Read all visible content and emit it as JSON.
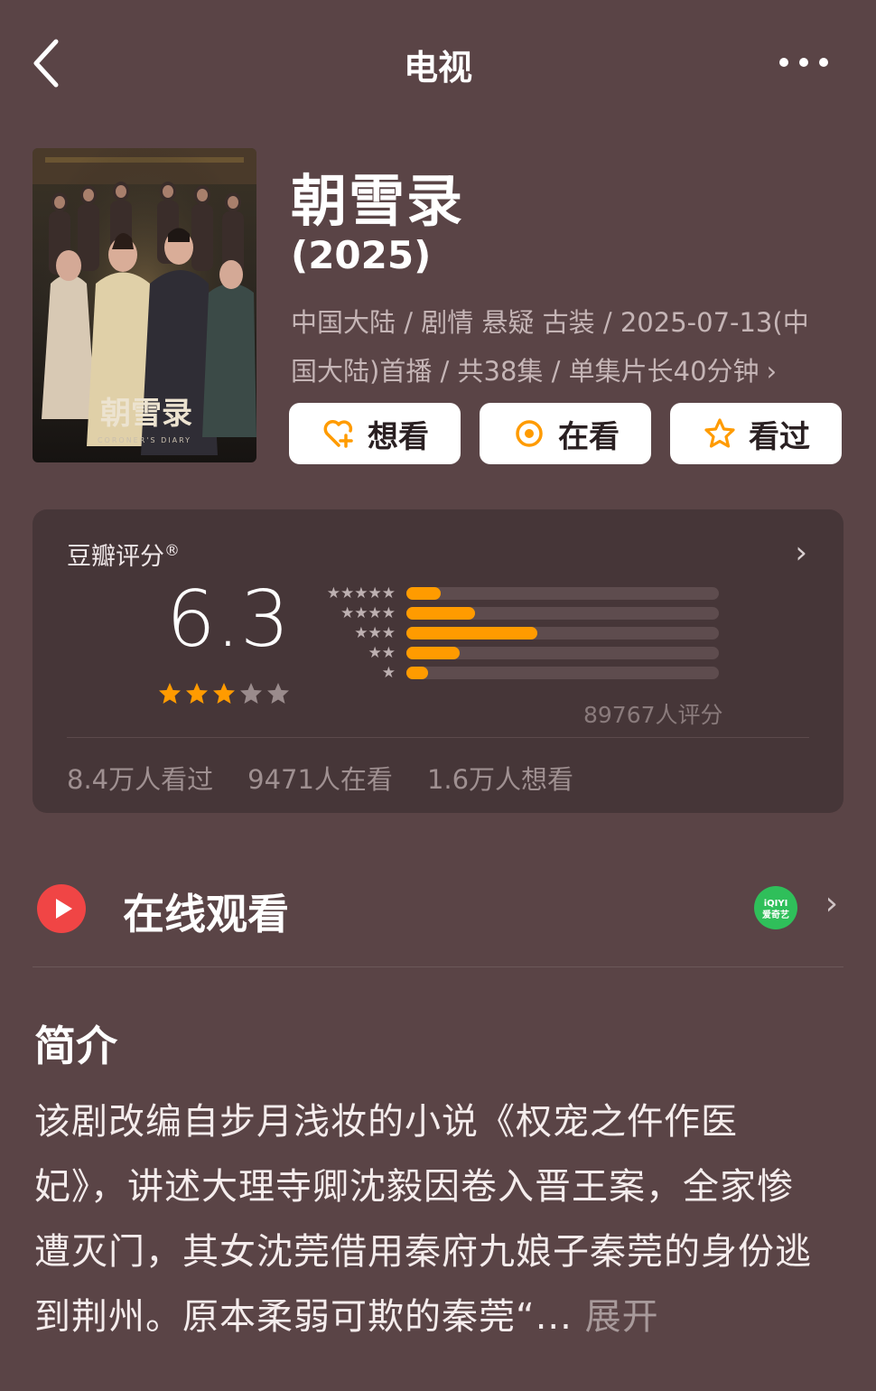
{
  "header": {
    "title": "电视",
    "back_icon": "chevron-left-icon",
    "more_icon": "more-horizontal-icon"
  },
  "poster": {
    "calligraphy": "朝雪录",
    "english_title": "CORONER'S DIARY"
  },
  "show": {
    "name": "朝雪录",
    "year": "(2025)",
    "meta_line1": "中国大陆 / 剧情 悬疑 古装 / 2025-07-13(中",
    "meta_line2": "国大陆)首播 / 共38集 / 单集片长40分钟",
    "meta_chevron": "›"
  },
  "actions": {
    "want": "想看",
    "watching": "在看",
    "watched": "看过"
  },
  "rating": {
    "label": "豆瓣评分",
    "registered": "®",
    "score": "6.3",
    "stars_filled": 3,
    "stars_total": 5,
    "distribution": [
      {
        "stars": 5,
        "fraction": 0.11
      },
      {
        "stars": 4,
        "fraction": 0.22
      },
      {
        "stars": 3,
        "fraction": 0.42
      },
      {
        "stars": 2,
        "fraction": 0.17
      },
      {
        "stars": 1,
        "fraction": 0.07
      }
    ],
    "count": "89767人评分",
    "stats": {
      "watched": "8.4万人看过",
      "watching": "9471人在看",
      "want": "1.6万人想看"
    },
    "chevron": "›"
  },
  "online": {
    "label": "在线观看",
    "provider": "爱奇艺",
    "provider_logo_text": "iQIYI",
    "chevron": "›"
  },
  "intro": {
    "heading": "简介",
    "text": "该剧改编自步月浅妆的小说《权宠之仵作医妃》，讲述大理寺卿沈毅因卷入晋王案，全家惨遭灭门，其女沈莞借用秦府九娘子秦莞的身份逃到荆州。原本柔弱可欺的秦莞“... ",
    "expand": "展开"
  },
  "colors": {
    "background": "#5a4446",
    "accent": "#ff9b00",
    "card": "#463638"
  }
}
